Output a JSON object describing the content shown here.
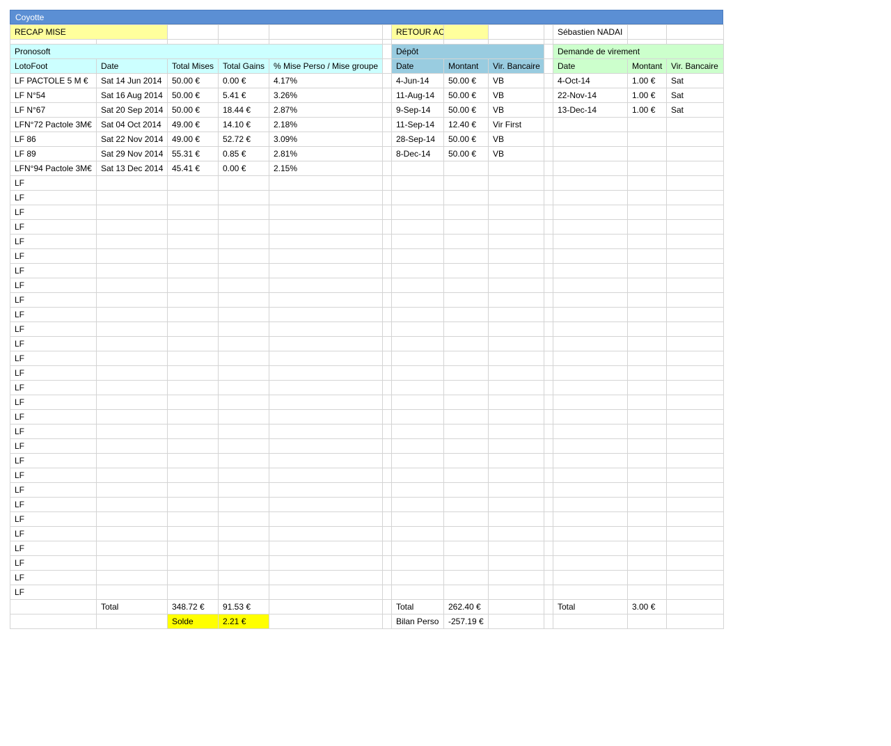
{
  "window_title": "Coyotte",
  "top": {
    "recap_label": "RECAP MISE",
    "retour_label": "RETOUR ACCUEIL",
    "user_name": "Sébastien NADAI"
  },
  "pronosoft": {
    "title": "Pronosoft",
    "headers": [
      "LotoFoot",
      "Date",
      "Total Mises",
      "Total Gains",
      "% Mise Perso / Mise groupe"
    ],
    "rows": [
      [
        "LF PACTOLE 5 M €",
        "Sat 14 Jun 2014",
        "50.00 €",
        "0.00 €",
        "4.17%"
      ],
      [
        "LF N°54",
        "Sat 16 Aug 2014",
        "50.00 €",
        "5.41 €",
        "3.26%"
      ],
      [
        "LF N°67",
        "Sat 20 Sep 2014",
        "50.00 €",
        "18.44 €",
        "2.87%"
      ],
      [
        "LFN°72 Pactole 3M€",
        "Sat 04 Oct 2014",
        "49.00 €",
        "14.10 €",
        "2.18%"
      ],
      [
        "LF 86",
        "Sat 22 Nov 2014",
        "49.00 €",
        "52.72 €",
        "3.09%"
      ],
      [
        "LF 89",
        "Sat 29 Nov 2014",
        "55.31 €",
        "0.85 €",
        "2.81%"
      ],
      [
        "LFN°94 Pactole 3M€",
        "Sat 13 Dec 2014",
        "45.41 €",
        "0.00 €",
        "2.15%"
      ]
    ],
    "placeholder_label": "LF",
    "total_label": "Total",
    "total_mises": "348.72 €",
    "total_gains": "91.53 €",
    "solde_label": "Solde",
    "solde_value": "2.21 €"
  },
  "depot": {
    "title": "Dépôt",
    "headers": [
      "Date",
      "Montant",
      "Vir. Bancaire"
    ],
    "rows": [
      [
        "4-Jun-14",
        "50.00 €",
        "VB"
      ],
      [
        "11-Aug-14",
        "50.00 €",
        "VB"
      ],
      [
        "9-Sep-14",
        "50.00 €",
        "VB"
      ],
      [
        "11-Sep-14",
        "12.40 €",
        "Vir First"
      ],
      [
        "28-Sep-14",
        "50.00 €",
        "VB"
      ],
      [
        "8-Dec-14",
        "50.00 €",
        "VB"
      ]
    ],
    "total_label": "Total",
    "total_value": "262.40 €",
    "bilan_label": "Bilan Perso",
    "bilan_value": "-257.19 €"
  },
  "virement": {
    "title": "Demande de virement",
    "headers": [
      "Date",
      "Montant",
      "Vir. Bancaire"
    ],
    "rows": [
      [
        "4-Oct-14",
        "1.00 €",
        "Sat"
      ],
      [
        "22-Nov-14",
        "1.00 €",
        "Sat"
      ],
      [
        "13-Dec-14",
        "1.00 €",
        "Sat"
      ]
    ],
    "total_label": "Total",
    "total_value": "3.00 €"
  },
  "colors": {
    "title_bar": "#5b8fd4",
    "yellow_pale": "#ffff9c",
    "cyan_pale": "#ccffff",
    "blue_mid": "#99cce0",
    "green_pale": "#ccffcc",
    "yellow_bright": "#ffff00"
  }
}
